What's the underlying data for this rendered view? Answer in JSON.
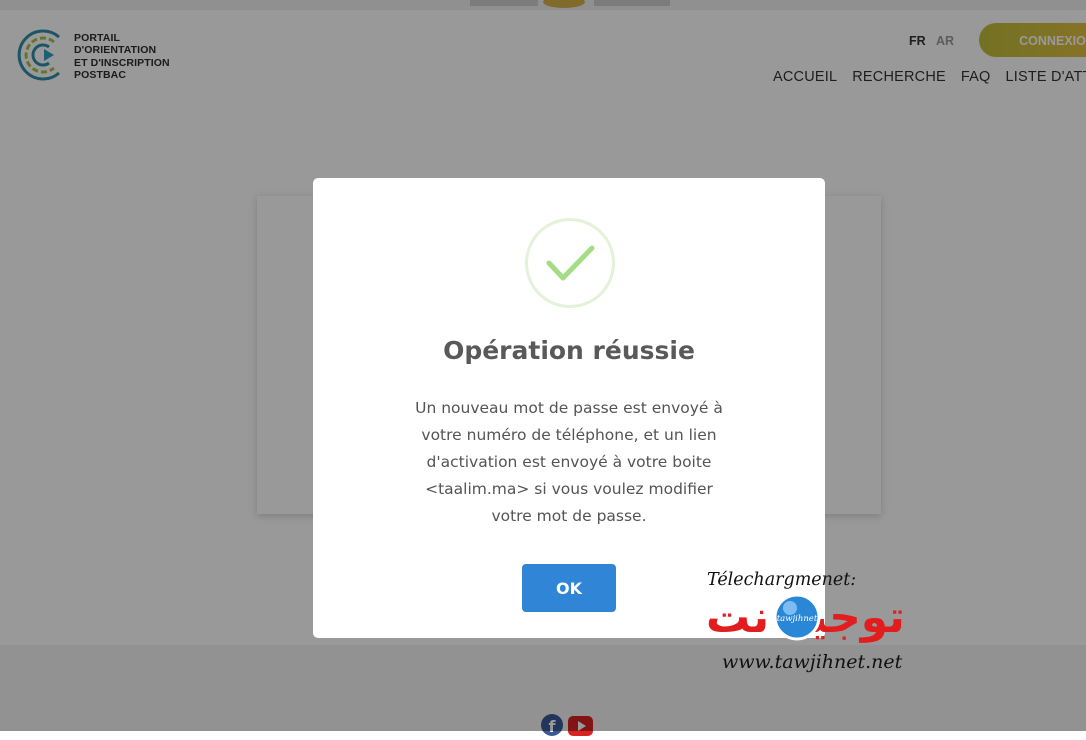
{
  "header": {
    "logo_lines": [
      "PORTAIL",
      "D'ORIENTATION",
      "ET D'INSCRIPTION",
      "POSTBAC"
    ],
    "languages": [
      "FR",
      "AR"
    ],
    "active_language": "FR",
    "login_button": "CONNEXION",
    "nav": [
      "ACCUEIL",
      "RECHERCHE",
      "FAQ",
      "LISTE D'ATTEN"
    ]
  },
  "modal": {
    "icon": "check-icon",
    "title": "Opération réussie",
    "message": "Un nouveau mot de passe est envoyé à votre numéro de téléphone, et un lien d'activation est envoyé à votre boite <taalim.ma> si vous voulez modifier votre mot de passe.",
    "ok_button": "OK"
  },
  "watermark": {
    "label": "Télechargmenet:",
    "arabic": "توجيه نت",
    "badge": "tawjihnet",
    "url": "www.tawjihnet.net"
  },
  "footer": {
    "social": [
      "facebook-icon",
      "youtube-icon"
    ]
  },
  "colors": {
    "primary_button": "#3085d6",
    "success": "#a5dc86",
    "login_gradient_start": "#bfbf3a",
    "login_gradient_end": "#e7c043",
    "watermark_red": "#e21d1d"
  }
}
